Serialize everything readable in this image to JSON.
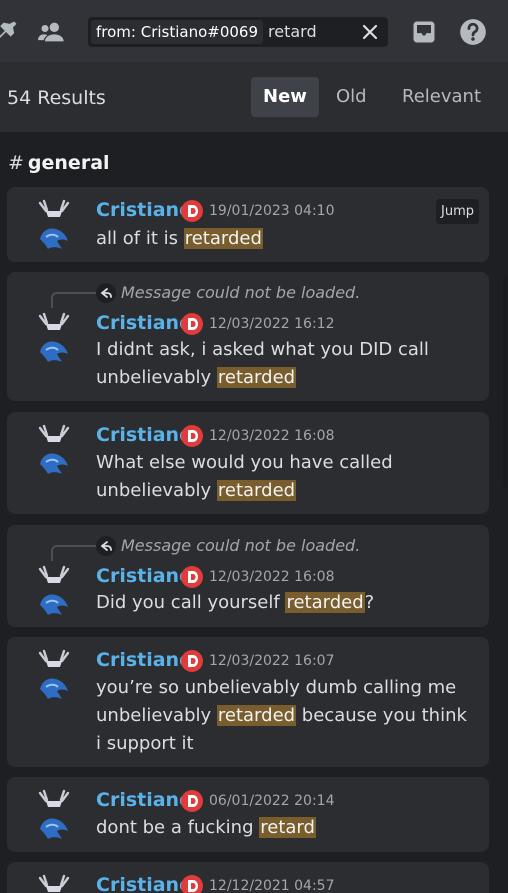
{
  "search": {
    "filter_chip": "from: Cristiano#0069",
    "query": "retard"
  },
  "results": {
    "count_label": "54 Results",
    "sort_tabs": [
      "New",
      "Old",
      "Relevant"
    ],
    "active_sort": "New"
  },
  "channel": {
    "hash": "#",
    "name": "general"
  },
  "jump_label": "Jump",
  "icons": [
    "pin-icon",
    "members-icon",
    "close-icon",
    "inbox-icon",
    "help-icon",
    "reply-icon",
    "moderator-badge-icon",
    "avatar"
  ],
  "colors": {
    "username": "#5ab2e8",
    "highlight": "#7a5d2c",
    "badge": "#e23b3b"
  },
  "messages": [
    {
      "author": "Cristiano",
      "timestamp": "19/01/2023 04:10",
      "reply": null,
      "parts": [
        "all of it is ",
        "retarded",
        ""
      ]
    },
    {
      "author": "Cristiano",
      "timestamp": "12/03/2022 16:12",
      "reply": "Message could not be loaded.",
      "parts": [
        "I didnt ask, i asked what you DID call unbelievably ",
        "retarded",
        ""
      ]
    },
    {
      "author": "Cristiano",
      "timestamp": "12/03/2022 16:08",
      "reply": null,
      "parts": [
        "What else would you have called unbelievably ",
        "retarded",
        ""
      ]
    },
    {
      "author": "Cristiano",
      "timestamp": "12/03/2022 16:08",
      "reply": "Message could not be loaded.",
      "parts": [
        "Did you call yourself ",
        "retarded",
        "?"
      ]
    },
    {
      "author": "Cristiano",
      "timestamp": "12/03/2022 16:07",
      "reply": null,
      "parts": [
        "you’re so unbelievably dumb calling me unbelievably ",
        "retarded",
        " because you think i support it"
      ]
    },
    {
      "author": "Cristiano",
      "timestamp": "06/01/2022 20:14",
      "reply": null,
      "parts": [
        "dont be a fucking ",
        "retard",
        ""
      ]
    },
    {
      "author": "Cristiano",
      "timestamp": "12/12/2021 04:57",
      "reply": null,
      "parts": [
        "",
        "",
        ""
      ]
    }
  ]
}
